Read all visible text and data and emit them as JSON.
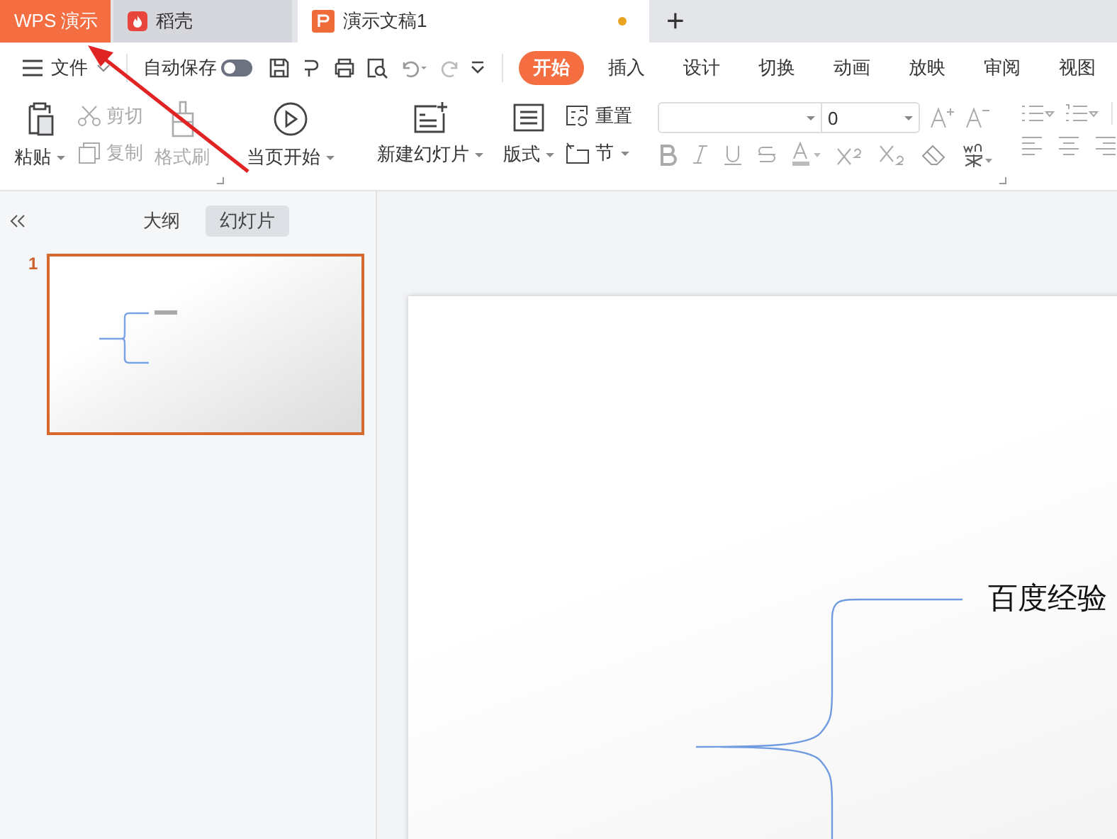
{
  "app_tabs": [
    {
      "label": "WPS 演示",
      "kind": "home",
      "selected": false
    },
    {
      "label": "稻壳",
      "kind": "docer",
      "selected": false
    },
    {
      "label": "演示文稿1",
      "kind": "doc",
      "selected": true,
      "unsaved": true
    }
  ],
  "new_tab": "+",
  "menu": {
    "file": "文件",
    "autosave": {
      "label": "自动保存",
      "on": false
    },
    "tabs": [
      {
        "label": "开始",
        "selected": true
      },
      {
        "label": "插入",
        "selected": false
      },
      {
        "label": "设计",
        "selected": false
      },
      {
        "label": "切换",
        "selected": false
      },
      {
        "label": "动画",
        "selected": false
      },
      {
        "label": "放映",
        "selected": false
      },
      {
        "label": "审阅",
        "selected": false
      },
      {
        "label": "视图",
        "selected": false
      }
    ]
  },
  "ribbon": {
    "paste": "粘贴",
    "cut": {
      "label": "剪切",
      "disabled": true
    },
    "copy": {
      "label": "复制",
      "disabled": true
    },
    "format_painter": {
      "label": "格式刷",
      "disabled": true
    },
    "play": "当页开始",
    "new_slide": "新建幻灯片",
    "layout": "版式",
    "reset": "重置",
    "section": "节",
    "font_size": "0"
  },
  "panel": {
    "view_tabs": [
      {
        "label": "大纲",
        "selected": false
      },
      {
        "label": "幻灯片",
        "selected": true
      }
    ],
    "slides": [
      {
        "number": "1",
        "selected": true
      }
    ]
  },
  "slide": {
    "title": "百度经验"
  }
}
